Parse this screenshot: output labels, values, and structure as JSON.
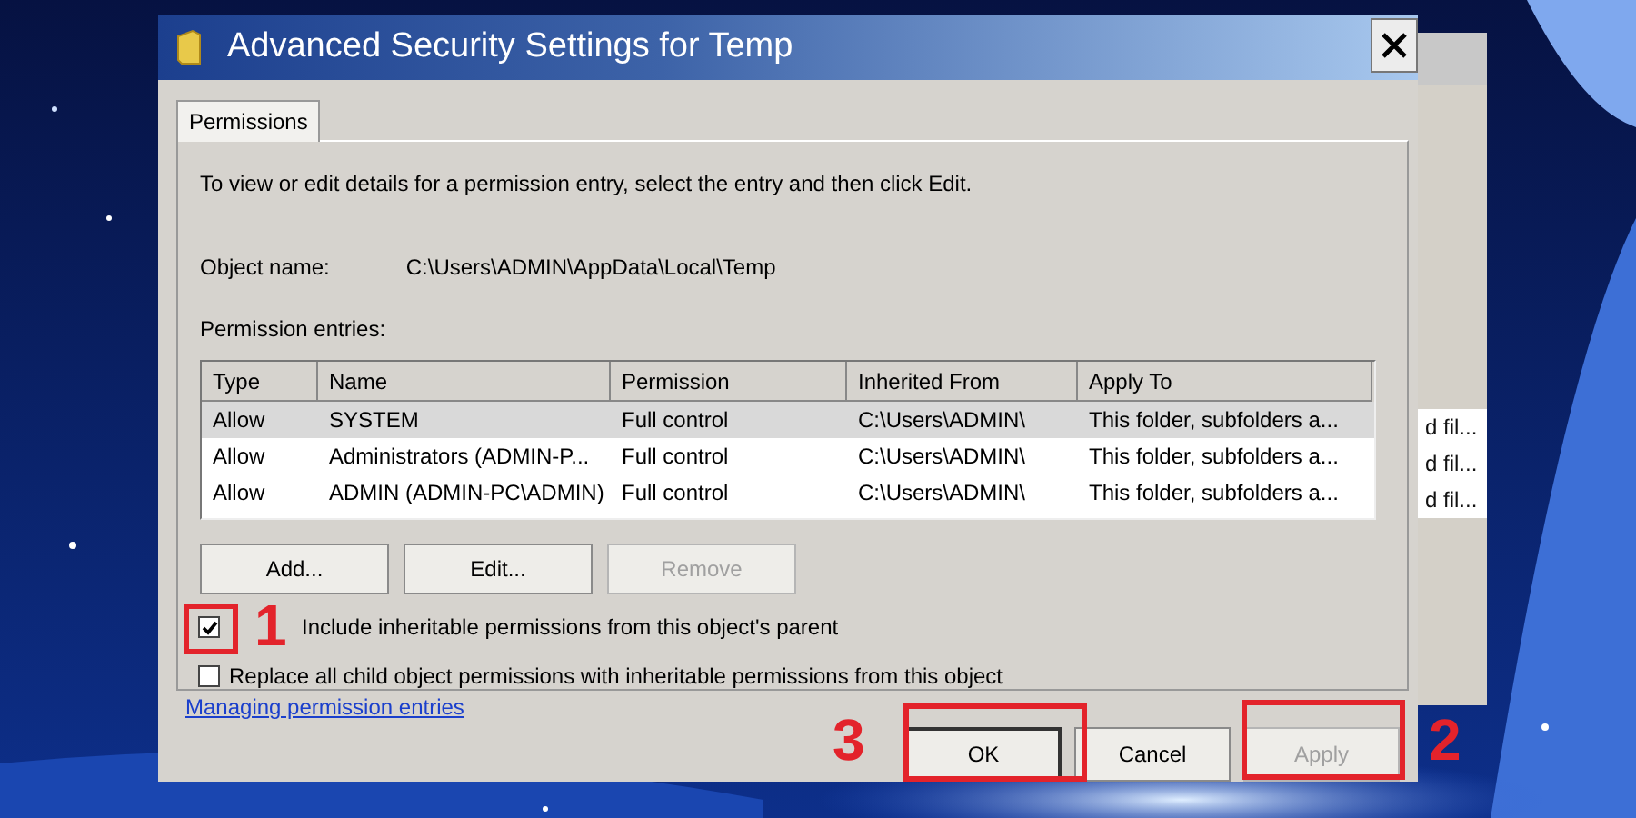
{
  "dialog": {
    "title": "Advanced Security Settings for Temp",
    "tabs": [
      {
        "label": "Permissions",
        "selected": true
      }
    ],
    "instructions": "To view or edit details for a permission entry, select the entry and then click Edit.",
    "object_name_label": "Object name:",
    "object_name": "C:\\Users\\ADMIN\\AppData\\Local\\Temp",
    "entries_label": "Permission entries:",
    "table": {
      "columns": [
        "Type",
        "Name",
        "Permission",
        "Inherited From",
        "Apply To"
      ],
      "rows": [
        {
          "cells": [
            "Allow",
            "SYSTEM",
            "Full control",
            "C:\\Users\\ADMIN\\",
            "This folder, subfolders a..."
          ],
          "selected": true
        },
        {
          "cells": [
            "Allow",
            "Administrators (ADMIN-P...",
            "Full control",
            "C:\\Users\\ADMIN\\",
            "This folder, subfolders a..."
          ],
          "selected": false
        },
        {
          "cells": [
            "Allow",
            "ADMIN (ADMIN-PC\\ADMIN)",
            "Full control",
            "C:\\Users\\ADMIN\\",
            "This folder, subfolders a..."
          ],
          "selected": false
        }
      ]
    },
    "entry_buttons": [
      {
        "label": "Add...",
        "disabled": false
      },
      {
        "label": "Edit...",
        "disabled": false
      },
      {
        "label": "Remove",
        "disabled": true
      }
    ],
    "options": [
      {
        "label": "Include inheritable permissions from this object's parent",
        "checked": true
      },
      {
        "label": "Replace all child object permissions with inheritable permissions from this object",
        "checked": false
      }
    ],
    "link": "Managing permission entries",
    "buttons": [
      {
        "label": "OK",
        "disabled": false,
        "default": true
      },
      {
        "label": "Cancel",
        "disabled": false,
        "default": false
      },
      {
        "label": "Apply",
        "disabled": true,
        "default": false
      }
    ]
  },
  "background_window": {
    "cells": [
      "d fil...",
      "d fil...",
      "d fil..."
    ]
  },
  "annotations": [
    {
      "label": "1"
    },
    {
      "label": "2"
    },
    {
      "label": "3"
    }
  ]
}
